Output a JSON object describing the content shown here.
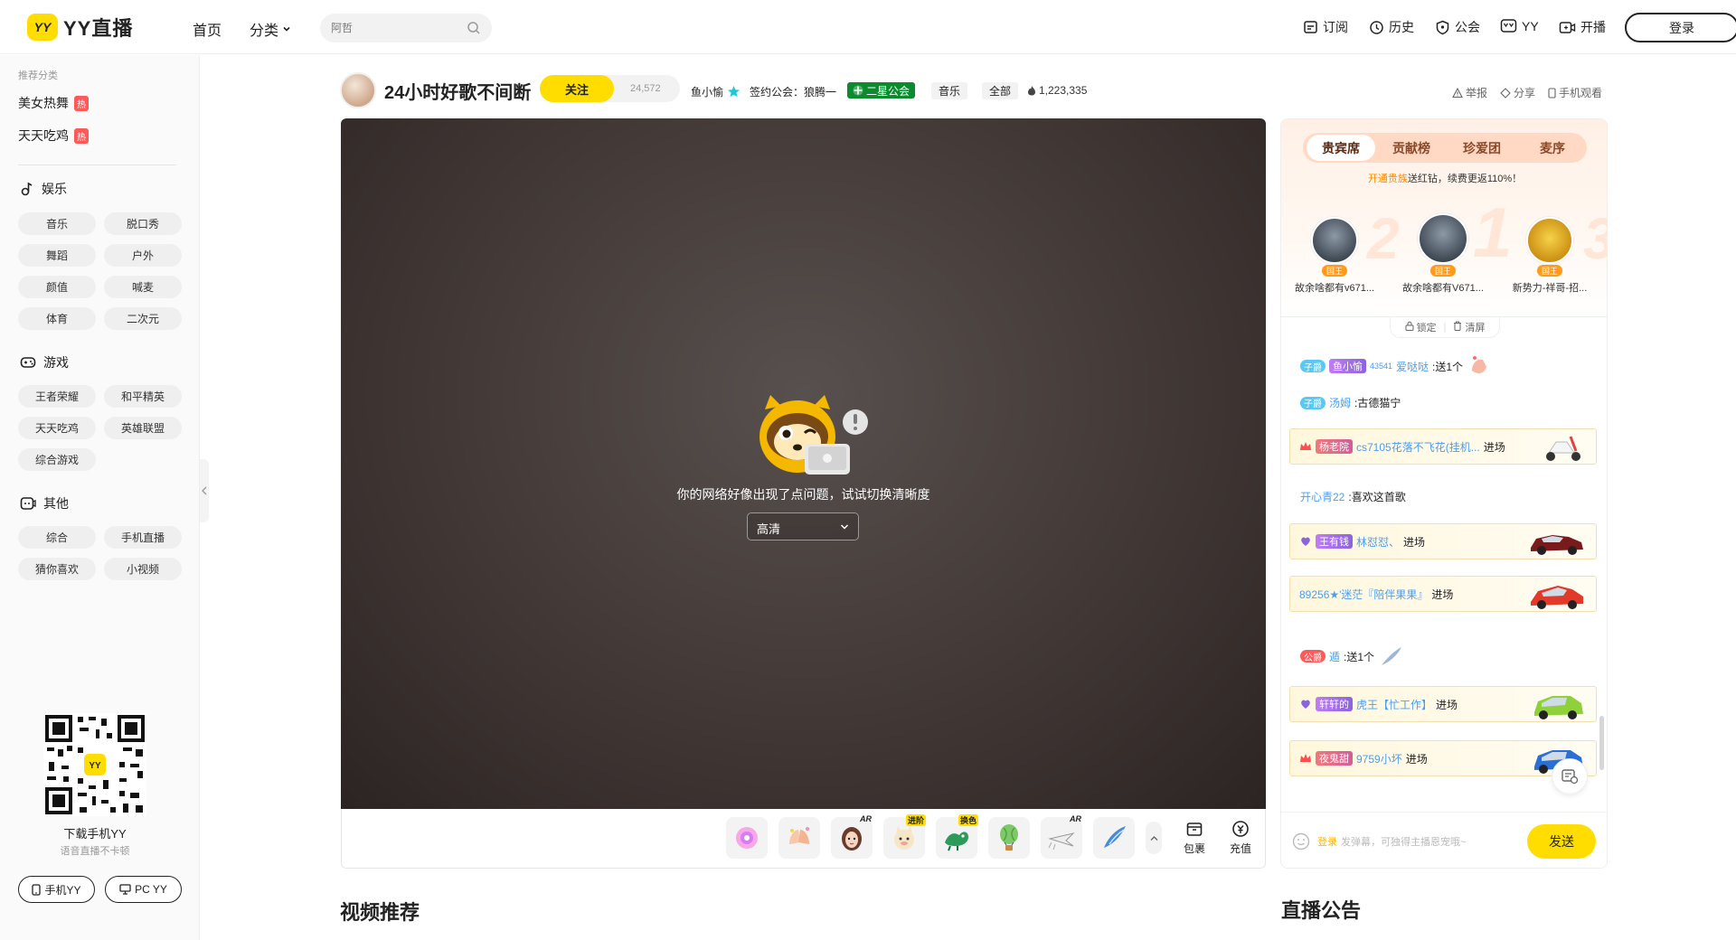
{
  "header": {
    "logo_badge": "YY",
    "logo_text": "YY直播",
    "nav_home": "首页",
    "nav_category": "分类",
    "search_placeholder": "阿哲",
    "links": {
      "subscribe": "订阅",
      "history": "历史",
      "guild": "公会",
      "yy": "YY",
      "broadcast": "开播"
    },
    "login": "登录"
  },
  "sidebar": {
    "caption": "推荐分类",
    "hot_items": [
      {
        "label": "美女热舞",
        "badge": "热"
      },
      {
        "label": "天天吃鸡",
        "badge": "热"
      }
    ],
    "sections": [
      {
        "title": "娱乐",
        "icon": "music-note-icon",
        "items": [
          "音乐",
          "脱口秀",
          "舞蹈",
          "户外",
          "颜值",
          "喊麦",
          "体育",
          "二次元"
        ]
      },
      {
        "title": "游戏",
        "icon": "gamepad-icon",
        "items": [
          "王者荣耀",
          "和平精英",
          "天天吃鸡",
          "英雄联盟",
          "综合游戏"
        ]
      },
      {
        "title": "其他",
        "icon": "other-icon",
        "items": [
          "综合",
          "手机直播",
          "猜你喜欢",
          "小视频"
        ]
      }
    ],
    "download_title": "下载手机YY",
    "download_sub": "语音直播不卡顿",
    "btn_mobile": "手机YY",
    "btn_pc": "PC YY"
  },
  "room": {
    "title": "24小时好歌不间断",
    "follow": "关注",
    "followers": "24,572",
    "anchor": "鱼小愉",
    "guild_label": "签约公会：狼腾一",
    "guild_tag": "二星公会",
    "tag_music": "音乐",
    "tag_all": "全部",
    "views": "1,223,335",
    "report": "举报",
    "share": "分享",
    "mobile_watch": "手机观看"
  },
  "player": {
    "error_text": "你的网络好像出现了点问题，试试切换清晰度",
    "quality": "高清"
  },
  "giftbar": {
    "gifts": [
      {
        "icon": "gift-flower-icon",
        "badge": ""
      },
      {
        "icon": "gift-hands-icon",
        "badge": ""
      },
      {
        "icon": "gift-girl-icon",
        "badge": "AR"
      },
      {
        "icon": "gift-cat-icon",
        "badge": "进阶"
      },
      {
        "icon": "gift-dragon-icon",
        "badge": "换色"
      },
      {
        "icon": "gift-balloon-icon",
        "badge": ""
      },
      {
        "icon": "gift-plane-icon",
        "badge": "AR"
      },
      {
        "icon": "gift-bird-icon",
        "badge": ""
      }
    ],
    "package": "包裹",
    "recharge": "充值"
  },
  "rightpanel": {
    "tabs": [
      "贵宾席",
      "贡献榜",
      "珍爱团",
      "麦序"
    ],
    "promo_highlight": "开通贵族",
    "promo_text": "送红钻，续费更返110%！",
    "ranks": [
      {
        "place": "2",
        "name": "故余啥都有v671...",
        "tag": "国王"
      },
      {
        "place": "1",
        "name": "故余啥都有V671...",
        "tag": "国王"
      },
      {
        "place": "3",
        "name": "新势力-祥哥-招...",
        "tag": "国王"
      }
    ],
    "lock": "锁定",
    "clear": "清屏",
    "chat": [
      {
        "level": "子爵",
        "badge": "鱼小愉",
        "prefix": "43541",
        "user": "爱哒哒",
        "text": ":送1个"
      },
      {
        "level": "子爵",
        "user": "汤姆",
        "text": ":古德猫宁"
      },
      {
        "badge": "杨老院",
        "user": "cs7105花落不飞花(挂机...",
        "text": "进场"
      },
      {
        "user": "开心青22",
        "text": ":喜欢这首歌"
      },
      {
        "badge": "王有钱",
        "user": "林怼怼、",
        "text": "进场"
      },
      {
        "user": "89256★'迷茫『陪伴果果』",
        "text": "进场"
      },
      {
        "level": "公爵",
        "user": "遁",
        "text": ":送1个"
      },
      {
        "badge": "轩轩的",
        "user": "虎王【忙工作】",
        "text": "进场"
      },
      {
        "badge": "夜鬼甜",
        "user": "9759小坏",
        "text": "进场"
      }
    ],
    "input_login": "登录",
    "input_placeholder": "发弹幕，可独得主播恩宠哦~",
    "send": "发送"
  },
  "sections": {
    "video_recommend": "视频推荐",
    "announcement": "直播公告"
  },
  "colors": {
    "brand_yellow": "#ffdd00",
    "guild_green": "#0a8b2e",
    "hot_red": "#ff5a5a",
    "link_blue": "#4a9ff0"
  }
}
